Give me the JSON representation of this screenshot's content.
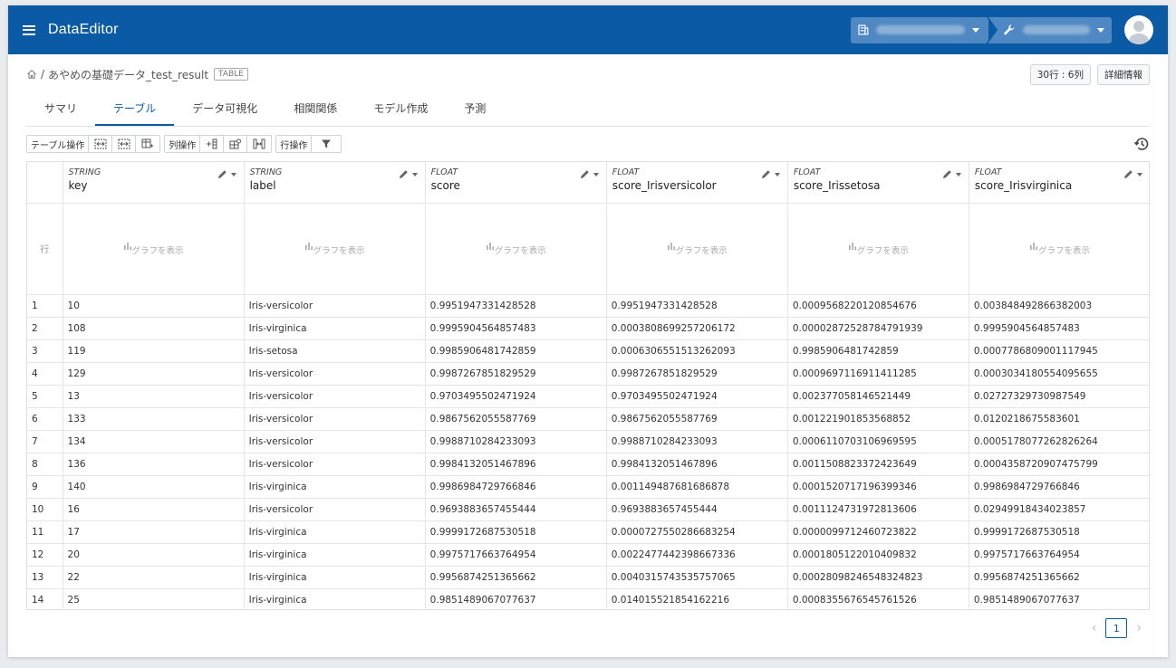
{
  "header": {
    "app_title": "DataEditor"
  },
  "breadcrumb": {
    "separator": "/",
    "dataset_name": "あやめの基礎データ_test_result",
    "badge": "TABLE"
  },
  "meta": {
    "size_label": "30行 : 6列",
    "details_label": "詳細情報"
  },
  "tabs": [
    {
      "label": "サマリ"
    },
    {
      "label": "テーブル"
    },
    {
      "label": "データ可視化"
    },
    {
      "label": "相関関係"
    },
    {
      "label": "モデル作成"
    },
    {
      "label": "予測"
    }
  ],
  "toolbar": {
    "table_ops": "テーブル操作",
    "col_ops": "列操作",
    "row_ops": "行操作"
  },
  "table": {
    "row_header_label": "行",
    "graph_label": "グラフを表示",
    "columns": [
      {
        "type": "STRING",
        "name": "key"
      },
      {
        "type": "STRING",
        "name": "label"
      },
      {
        "type": "FLOAT",
        "name": "score"
      },
      {
        "type": "FLOAT",
        "name": "score_Irisversicolor"
      },
      {
        "type": "FLOAT",
        "name": "score_Irissetosa"
      },
      {
        "type": "FLOAT",
        "name": "score_Irisvirginica"
      }
    ],
    "rows": [
      [
        "1",
        "10",
        "Iris-versicolor",
        "0.9951947331428528",
        "0.9951947331428528",
        "0.0009568220120854676",
        "0.003848492866382003"
      ],
      [
        "2",
        "108",
        "Iris-virginica",
        "0.9995904564857483",
        "0.0003808699257206172",
        "0.00002872528784791939",
        "0.9995904564857483"
      ],
      [
        "3",
        "119",
        "Iris-setosa",
        "0.9985906481742859",
        "0.0006306551513262093",
        "0.9985906481742859",
        "0.0007786809001117945"
      ],
      [
        "4",
        "129",
        "Iris-versicolor",
        "0.9987267851829529",
        "0.9987267851829529",
        "0.0009697116911411285",
        "0.0003034180554095655"
      ],
      [
        "5",
        "13",
        "Iris-versicolor",
        "0.9703495502471924",
        "0.9703495502471924",
        "0.002377058146521449",
        "0.02727329730987549"
      ],
      [
        "6",
        "133",
        "Iris-versicolor",
        "0.9867562055587769",
        "0.9867562055587769",
        "0.001221901853568852",
        "0.0120218675583601"
      ],
      [
        "7",
        "134",
        "Iris-versicolor",
        "0.9988710284233093",
        "0.9988710284233093",
        "0.0006110703106969595",
        "0.0005178077262826264"
      ],
      [
        "8",
        "136",
        "Iris-versicolor",
        "0.9984132051467896",
        "0.9984132051467896",
        "0.0011508823372423649",
        "0.0004358720907475799"
      ],
      [
        "9",
        "140",
        "Iris-virginica",
        "0.9986984729766846",
        "0.001149487681686878",
        "0.0001520717196399346",
        "0.9986984729766846"
      ],
      [
        "10",
        "16",
        "Iris-versicolor",
        "0.9693883657455444",
        "0.9693883657455444",
        "0.0011124731972813606",
        "0.02949918434023857"
      ],
      [
        "11",
        "17",
        "Iris-virginica",
        "0.9999172687530518",
        "0.0000727550286683254",
        "0.0000099712460723822",
        "0.9999172687530518"
      ],
      [
        "12",
        "20",
        "Iris-virginica",
        "0.9975717663764954",
        "0.0022477442398667336",
        "0.0001805122010409832",
        "0.9975717663764954"
      ],
      [
        "13",
        "22",
        "Iris-virginica",
        "0.9956874251365662",
        "0.0040315743535757065",
        "0.00028098246548324823",
        "0.9956874251365662"
      ],
      [
        "14",
        "25",
        "Iris-virginica",
        "0.9851489067077637",
        "0.014015521854162216",
        "0.0008355676545761526",
        "0.9851489067077637"
      ]
    ]
  },
  "pagination": {
    "current": "1"
  },
  "icons": {
    "menu": "menu-icon",
    "org": "building-icon",
    "workspace": "wrench-icon",
    "avatar": "user-avatar",
    "home": "home-icon",
    "history": "history-icon",
    "edit": "pencil-icon",
    "graph": "bar-chart-icon",
    "filter": "filter-icon"
  },
  "colors": {
    "primary": "#0a5aa5",
    "header_select": "#4f88c3"
  }
}
